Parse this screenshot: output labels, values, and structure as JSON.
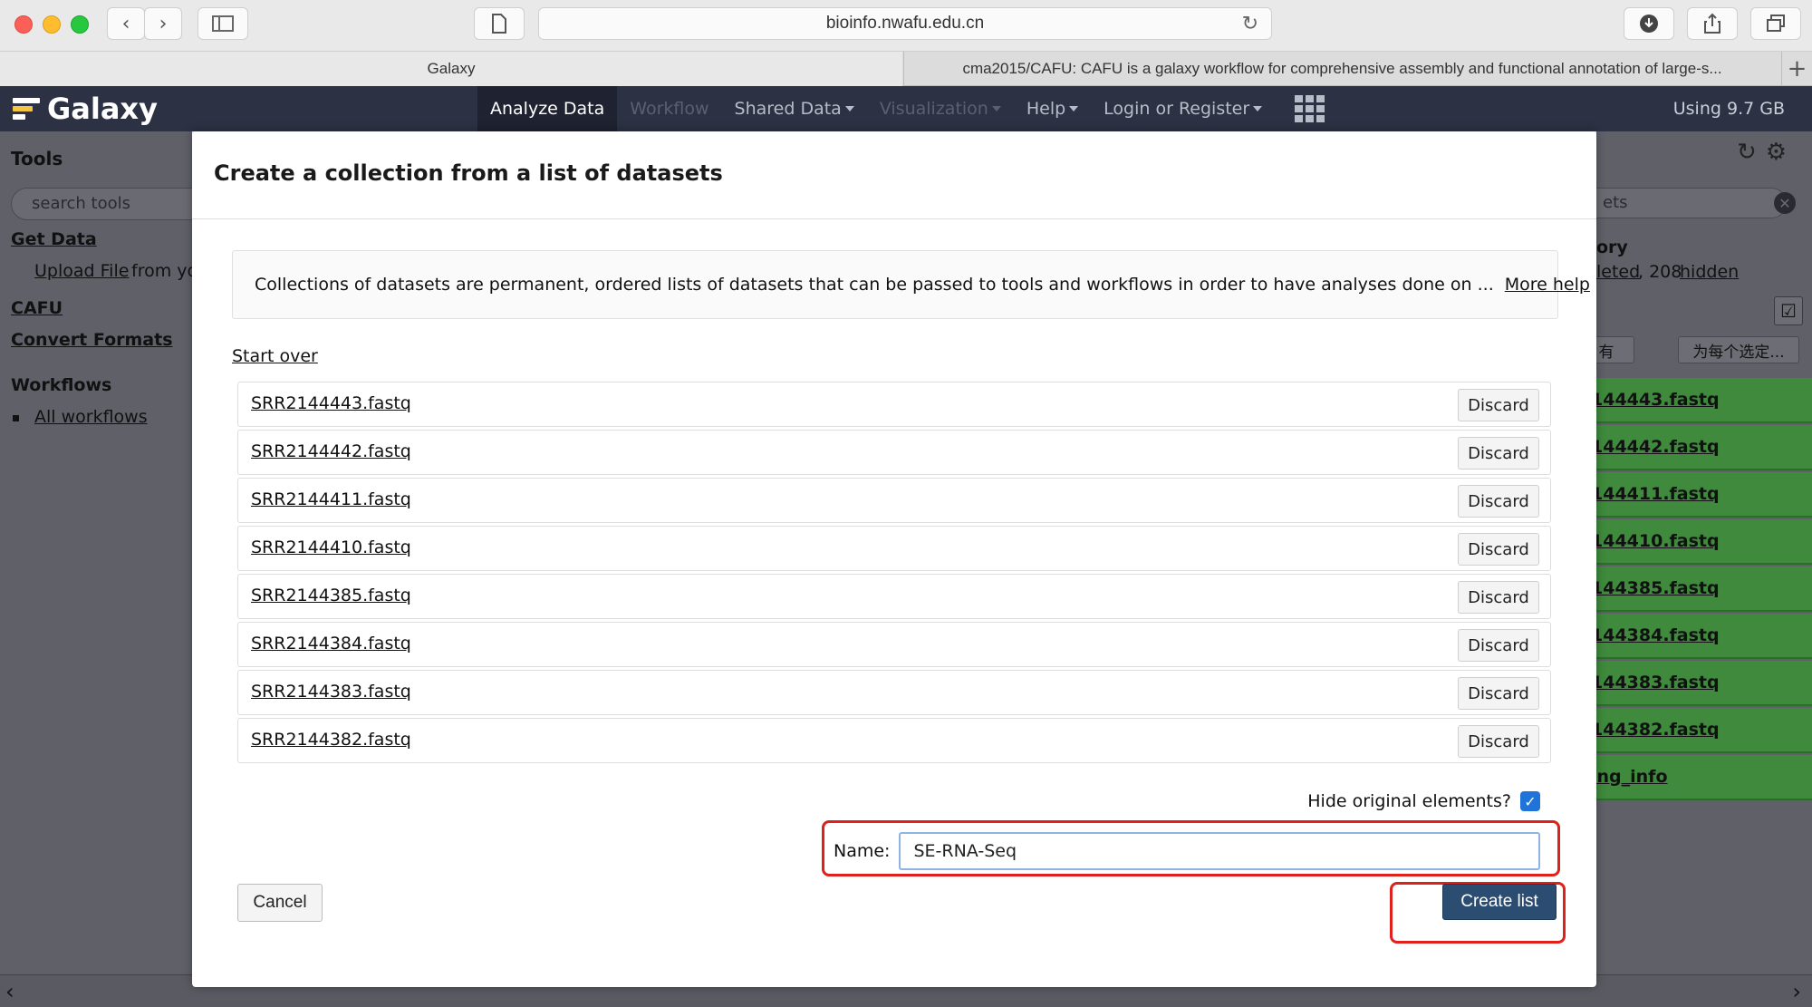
{
  "browser": {
    "url": "bioinfo.nwafu.edu.cn",
    "tabs": [
      {
        "label": "Galaxy"
      },
      {
        "label": "cma2015/CAFU: CAFU is a galaxy workflow for comprehensive assembly and functional annotation of large-s..."
      }
    ]
  },
  "masthead": {
    "brand": "Galaxy",
    "nav": [
      {
        "label": "Analyze Data"
      },
      {
        "label": "Workflow"
      },
      {
        "label": "Shared Data"
      },
      {
        "label": "Visualization"
      },
      {
        "label": "Help"
      },
      {
        "label": "Login or Register"
      }
    ],
    "quota": "Using 9.7 GB"
  },
  "tool_panel": {
    "title": "Tools",
    "search_placeholder": "search tools",
    "get_data": "Get Data",
    "upload_file": "Upload File",
    "upload_suffix": "from yo",
    "cafu": "CAFU",
    "convert_formats": "Convert Formats",
    "workflows_heading": "Workflows",
    "all_workflows": "All workflows"
  },
  "history_panel": {
    "search_fragment": "ets",
    "heading_fragment": "ory",
    "deleted_fragment": "leted",
    "hidden_count": ", 208",
    "hidden_label": "hidden",
    "btn_all_fragment": "有",
    "btn_selected": "为每个选定...",
    "items": [
      {
        "label": "144443.fastq"
      },
      {
        "label": "144442.fastq"
      },
      {
        "label": "144411.fastq"
      },
      {
        "label": "144410.fastq"
      },
      {
        "label": "144385.fastq"
      },
      {
        "label": "144384.fastq"
      },
      {
        "label": "144383.fastq"
      },
      {
        "label": "144382.fastq"
      },
      {
        "label": "ing_info"
      }
    ]
  },
  "modal": {
    "title": "Create a collection from a list of datasets",
    "help_text": "Collections of datasets are permanent, ordered lists of datasets that can be passed to tools and workflows in order to have analyses done on ...",
    "more_help": "More help",
    "start_over": "Start over",
    "elements": [
      {
        "name": "SRR2144443.fastq",
        "discard": "Discard"
      },
      {
        "name": "SRR2144442.fastq",
        "discard": "Discard"
      },
      {
        "name": "SRR2144411.fastq",
        "discard": "Discard"
      },
      {
        "name": "SRR2144410.fastq",
        "discard": "Discard"
      },
      {
        "name": "SRR2144385.fastq",
        "discard": "Discard"
      },
      {
        "name": "SRR2144384.fastq",
        "discard": "Discard"
      },
      {
        "name": "SRR2144383.fastq",
        "discard": "Discard"
      },
      {
        "name": "SRR2144382.fastq",
        "discard": "Discard"
      }
    ],
    "hide_original_label": "Hide original elements?",
    "hide_original_checked": true,
    "name_label": "Name:",
    "name_value": "SE-RNA-Seq",
    "cancel": "Cancel",
    "create_list": "Create list"
  },
  "colors": {
    "masthead": "#2c3143",
    "primary_button": "#2c4d72",
    "highlight": "#e0201b",
    "history_ok": "#3f8a3d"
  }
}
